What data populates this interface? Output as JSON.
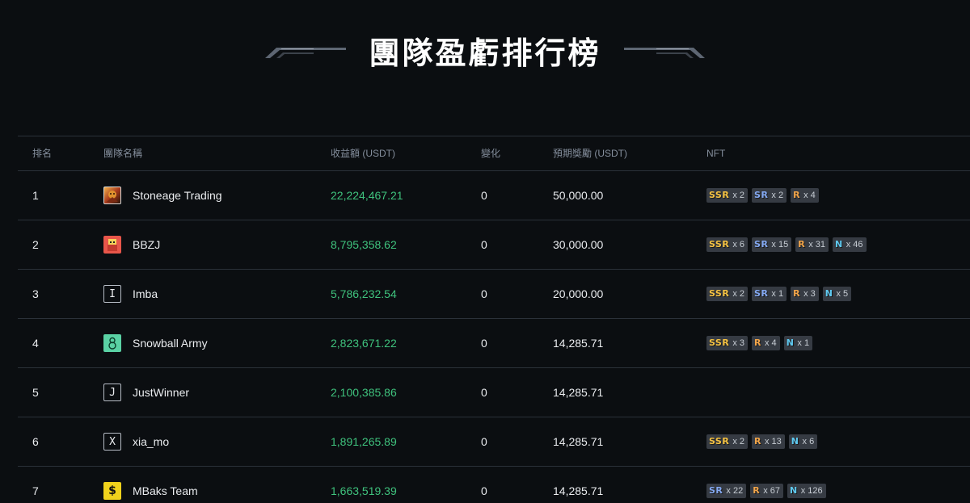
{
  "page": {
    "title": "團隊盈虧排行榜"
  },
  "table": {
    "headers": {
      "rank": "排名",
      "team": "團隊名稱",
      "pnl": "收益額 (USDT)",
      "change": "變化",
      "prize": "預期獎勵 (USDT)",
      "nft": "NFT"
    },
    "rows": [
      {
        "rank": "1",
        "avatar": {
          "type": "image",
          "icon": "team-logo-stoneage",
          "letter": ""
        },
        "team": "Stoneage Trading",
        "pnl": "22,224,467.21",
        "change": "0",
        "prize": "50,000.00",
        "nft": [
          {
            "tier": "SSR",
            "count": "x 2"
          },
          {
            "tier": "SR",
            "count": "x 2"
          },
          {
            "tier": "R",
            "count": "x 4"
          }
        ]
      },
      {
        "rank": "2",
        "avatar": {
          "type": "image",
          "icon": "team-logo-bbzj",
          "letter": ""
        },
        "team": "BBZJ",
        "pnl": "8,795,358.62",
        "change": "0",
        "prize": "30,000.00",
        "nft": [
          {
            "tier": "SSR",
            "count": "x 6"
          },
          {
            "tier": "SR",
            "count": "x 15"
          },
          {
            "tier": "R",
            "count": "x 31"
          },
          {
            "tier": "N",
            "count": "x 46"
          }
        ]
      },
      {
        "rank": "3",
        "avatar": {
          "type": "letter",
          "icon": "team-initial-avatar",
          "letter": "I"
        },
        "team": "Imba",
        "pnl": "5,786,232.54",
        "change": "0",
        "prize": "20,000.00",
        "nft": [
          {
            "tier": "SSR",
            "count": "x 2"
          },
          {
            "tier": "SR",
            "count": "x 1"
          },
          {
            "tier": "R",
            "count": "x 3"
          },
          {
            "tier": "N",
            "count": "x 5"
          }
        ]
      },
      {
        "rank": "4",
        "avatar": {
          "type": "snow",
          "icon": "snowman-icon",
          "letter": ""
        },
        "team": "Snowball Army",
        "pnl": "2,823,671.22",
        "change": "0",
        "prize": "14,285.71",
        "nft": [
          {
            "tier": "SSR",
            "count": "x 3"
          },
          {
            "tier": "R",
            "count": "x 4"
          },
          {
            "tier": "N",
            "count": "x 1"
          }
        ]
      },
      {
        "rank": "5",
        "avatar": {
          "type": "letter",
          "icon": "team-initial-avatar",
          "letter": "J"
        },
        "team": "JustWinner",
        "pnl": "2,100,385.86",
        "change": "0",
        "prize": "14,285.71",
        "nft": []
      },
      {
        "rank": "6",
        "avatar": {
          "type": "letter",
          "icon": "team-initial-avatar",
          "letter": "X"
        },
        "team": "xia_mo",
        "pnl": "1,891,265.89",
        "change": "0",
        "prize": "14,285.71",
        "nft": [
          {
            "tier": "SSR",
            "count": "x 2"
          },
          {
            "tier": "R",
            "count": "x 13"
          },
          {
            "tier": "N",
            "count": "x 6"
          }
        ]
      },
      {
        "rank": "7",
        "avatar": {
          "type": "mbaks",
          "icon": "dollar-sign-icon",
          "letter": "$"
        },
        "team": "MBaks Team",
        "pnl": "1,663,519.39",
        "change": "0",
        "prize": "14,285.71",
        "nft": [
          {
            "tier": "SR",
            "count": "x 22"
          },
          {
            "tier": "R",
            "count": "x 67"
          },
          {
            "tier": "N",
            "count": "x 126"
          }
        ]
      }
    ]
  },
  "colors": {
    "background": "#0b0e11",
    "positive": "#3fc27d",
    "divider": "#2b3139",
    "ssr": "#f6c343",
    "sr": "#84a9f2",
    "r": "#f2a54a",
    "n": "#5ec9f0"
  }
}
